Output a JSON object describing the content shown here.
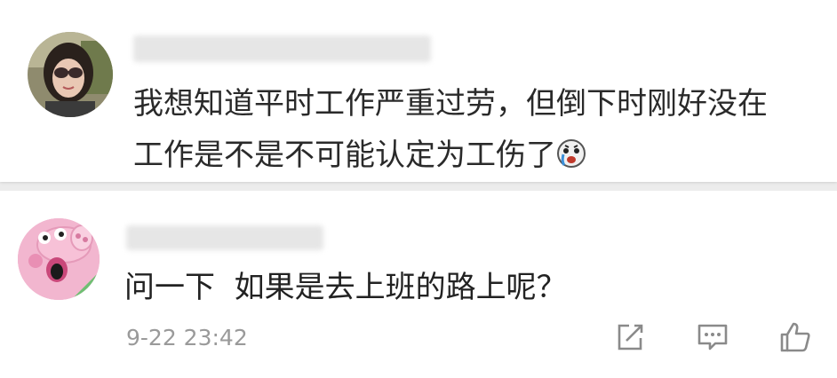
{
  "quoted_comment": {
    "text_line1": "我想知道平时工作严重过劳，但倒下时刚好没在",
    "text_line2": "工作是不是不可能认定为工伤了",
    "emoji": "crying-face-icon"
  },
  "reply": {
    "text": "问一下  如果是去上班的路上呢？",
    "timestamp": "9-22 23:42"
  },
  "actions": [
    {
      "icon": "share-icon"
    },
    {
      "icon": "comment-icon"
    },
    {
      "icon": "like-icon"
    }
  ],
  "colors": {
    "background": "#ececec",
    "card": "#ffffff",
    "text": "#2b2b2b",
    "meta": "#9a9a9a",
    "peppa_pink": "#f2b6cf"
  }
}
